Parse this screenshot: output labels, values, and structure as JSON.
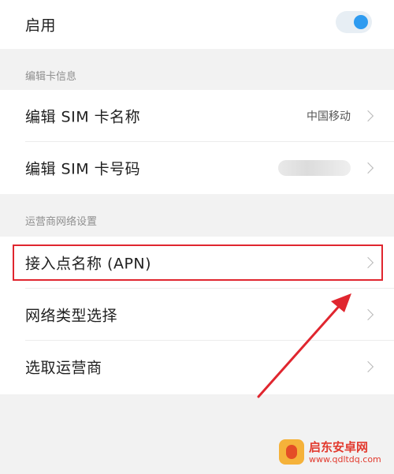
{
  "enable_row": {
    "label": "启用",
    "toggle_on": true
  },
  "sections": {
    "card_info_header": "编辑卡信息",
    "carrier_settings_header": "运营商网络设置"
  },
  "card_info": {
    "edit_sim_name": {
      "label": "编辑 SIM 卡名称",
      "value": "中国移动"
    },
    "edit_sim_number": {
      "label": "编辑 SIM 卡号码",
      "value": ""
    }
  },
  "carrier_settings": {
    "items": [
      {
        "label": "接入点名称 (APN)"
      },
      {
        "label": "网络类型选择"
      },
      {
        "label": "选取运营商"
      }
    ]
  },
  "annotation": {
    "highlight_color": "#e0262f"
  },
  "watermark": {
    "title": "启东安卓网",
    "subtitle": "www.qdltdq.com"
  },
  "colors": {
    "toggle_accent": "#2e9bf0",
    "background": "#f2f2f2",
    "card": "#ffffff"
  },
  "icons": {
    "chevron": "chevron-right-icon",
    "arrow": "red-arrow-annotation"
  }
}
